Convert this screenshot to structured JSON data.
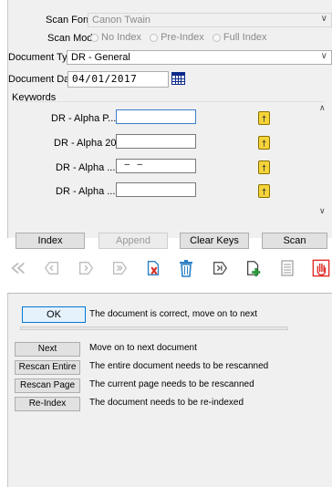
{
  "scan_format": {
    "label": "Scan Format",
    "value": "Canon Twain"
  },
  "scan_mode": {
    "label": "Scan Mode",
    "options": [
      "No Index",
      "Pre-Index",
      "Full Index"
    ]
  },
  "document_type": {
    "label": "Document Type",
    "value": "DR - General"
  },
  "document_date": {
    "label": "Document Date",
    "value": "04/01/2017"
  },
  "keywords": {
    "title": "Keywords",
    "rows": [
      {
        "label": "DR - Alpha P...",
        "value": ""
      },
      {
        "label": "DR - Alpha 20",
        "value": ""
      },
      {
        "label": "DR - Alpha ...",
        "value": "  –   –"
      },
      {
        "label": "DR - Alpha ...",
        "value": ""
      }
    ]
  },
  "buttons": {
    "index": "Index",
    "append": "Append",
    "clear_keys": "Clear Keys",
    "scan": "Scan"
  },
  "toolbar_icons": [
    "first-page-icon",
    "prev-page-icon",
    "next-page-icon",
    "last-page-icon",
    "delete-page-icon",
    "trash-icon",
    "move-last-icon",
    "add-page-icon",
    "page-list-icon",
    "stop-hand-icon"
  ],
  "review": {
    "ok": {
      "label": "OK",
      "text": "The document is correct, move on to next"
    },
    "next": {
      "label": "Next",
      "text": "Move on to next document"
    },
    "rescan_entire": {
      "label": "Rescan Entire",
      "text": "The entire document needs to be rescanned"
    },
    "rescan_page": {
      "label": "Rescan Page",
      "text": "The current page needs to be rescanned"
    },
    "reindex": {
      "label": "Re-Index",
      "text": "The document needs to be re-indexed"
    }
  },
  "colors": {
    "panel": "#f0f0f0",
    "stop": "#e0302a",
    "delete": "#d9291c",
    "add": "#2a9a3a"
  }
}
